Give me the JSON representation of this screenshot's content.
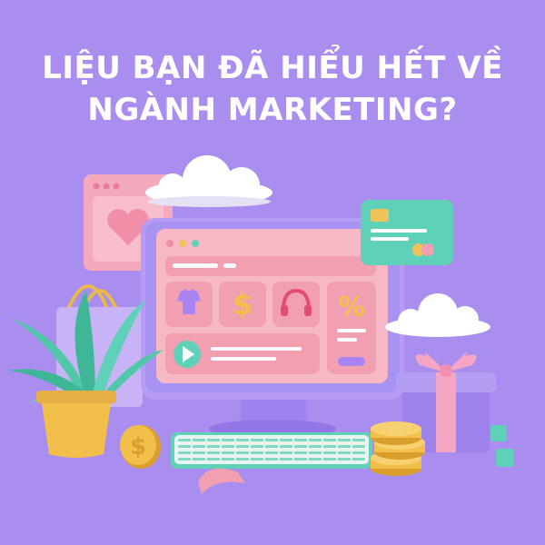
{
  "headline": {
    "line1": "LIỆU BẠN ĐÃ HIỂU HẾT VỀ",
    "line2": "NGÀNH MARKETING?"
  },
  "screen_icons": {
    "price_tile": "$",
    "discount_tile": "%",
    "coin": "$"
  },
  "icons": [
    "heart-icon",
    "shirt-icon",
    "dollar-icon",
    "headphones-icon",
    "percent-icon",
    "play-icon",
    "cloud-icon",
    "credit-card-icon",
    "gift-icon",
    "plant-icon",
    "shopping-bag-icon",
    "coin-icon",
    "keyboard-icon",
    "mouse-icon"
  ],
  "colors": {
    "background": "#a98ef0",
    "monitor": "#b69cf5",
    "screen": "#f7b8c6",
    "tile": "#f39fb2",
    "teal": "#5fd1b9",
    "gold": "#f2bf4a",
    "text": "#ffffff"
  }
}
